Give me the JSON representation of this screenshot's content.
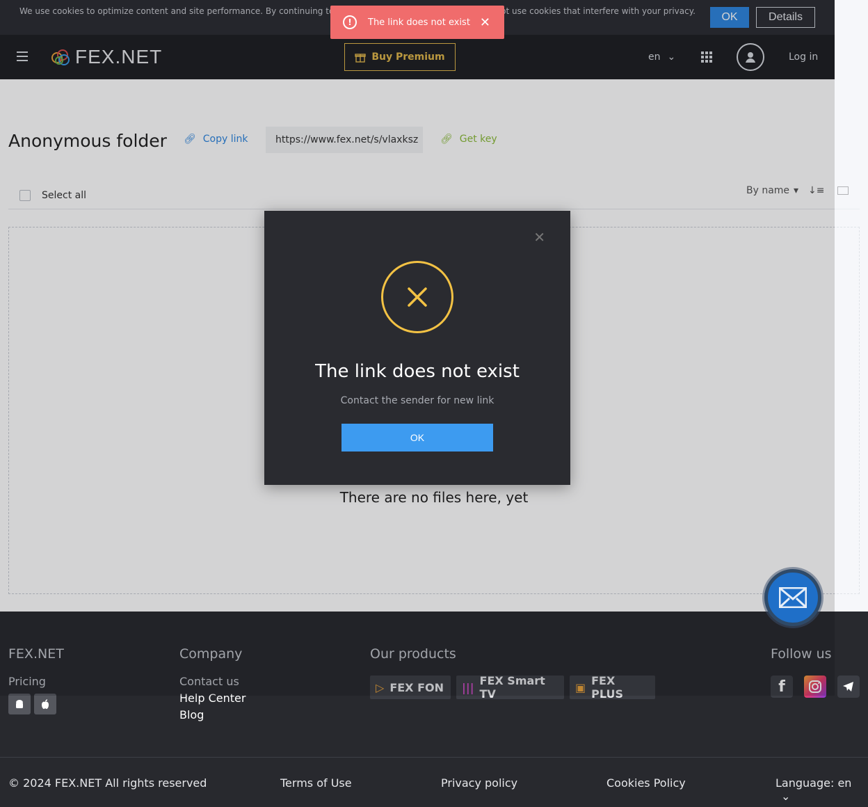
{
  "cookie": {
    "text": "We use cookies to optimize content and site performance. By continuing to use the site, you agree to this. We do not use cookies that interfere with your privacy.",
    "ok_label": "OK",
    "details_label": "Details"
  },
  "toast": {
    "message": "The link does not exist"
  },
  "header": {
    "logo_text": "FEX.NET",
    "premium_label": "Buy Premium",
    "lang": "en",
    "login_label": "Log in"
  },
  "folder": {
    "title": "Anonymous folder",
    "copy_link_label": "Copy link",
    "url": "https://www.fex.net/s/vlaxksz",
    "get_key_label": "Get key",
    "select_all_label": "Select all",
    "sort_label": "By name",
    "empty_text": "There are no files here, yet"
  },
  "modal": {
    "title": "The link does not exist",
    "subtitle": "Contact the sender for new link",
    "ok_label": "OK"
  },
  "footer": {
    "col1_title": "FEX.NET",
    "pricing": "Pricing",
    "col2_title": "Company",
    "contact": "Contact us",
    "help": "Help Center",
    "blog": "Blog",
    "col3_title": "Our products",
    "products": [
      "FEX FON",
      "FEX Smart TV",
      "FEX PLUS"
    ],
    "col4_title": "Follow us",
    "copyright": "© 2024 FEX.NET All rights reserved",
    "terms": "Terms of Use",
    "privacy": "Privacy policy",
    "cookies": "Cookies Policy",
    "language": "Language: en"
  },
  "colors": {
    "accent": "#2e86de",
    "toast": "#f06c6c",
    "warning_ring": "#f3c244",
    "premium": "#e1b84a"
  }
}
